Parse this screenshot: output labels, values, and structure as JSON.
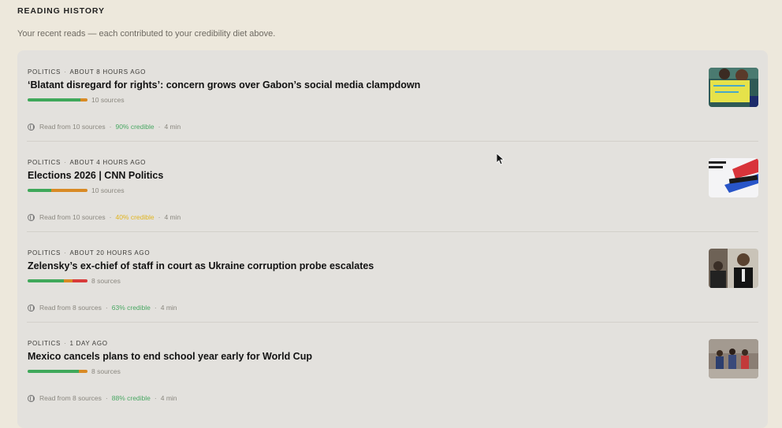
{
  "section": {
    "title": "READING HISTORY",
    "subtitle": "Your recent reads — each contributed to your credibility diet above."
  },
  "items": [
    {
      "category": "POLITICS",
      "time": "ABOUT 8 HOURS AGO",
      "headline": "‘Blatant disregard for rights’: concern grows over Gabon’s social media clampdown",
      "sources_label": "10 sources",
      "read_from": "Read from 10 sources",
      "credibility": "90% credible",
      "credibility_color": "#4aa864",
      "read_time": "4 min",
      "bar": [
        {
          "color": "#3fa85a",
          "share": 0.88
        },
        {
          "color": "#d98a24",
          "share": 0.12
        }
      ],
      "thumb_icon": "protest-photo"
    },
    {
      "category": "POLITICS",
      "time": "ABOUT 4 HOURS AGO",
      "headline": "Elections 2026 | CNN Politics",
      "sources_label": "10 sources",
      "read_from": "Read from 10 sources",
      "credibility": "40% credible",
      "credibility_color": "#e0b521",
      "read_time": "4 min",
      "bar": [
        {
          "color": "#3fa85a",
          "share": 0.4
        },
        {
          "color": "#d98a24",
          "share": 0.6
        }
      ],
      "thumb_icon": "vote-sign-photo"
    },
    {
      "category": "POLITICS",
      "time": "ABOUT 20 HOURS AGO",
      "headline": "Zelensky’s ex-chief of staff in court as Ukraine corruption probe escalates",
      "sources_label": "8 sources",
      "read_from": "Read from 8 sources",
      "credibility": "63% credible",
      "credibility_color": "#4aa864",
      "read_time": "4 min",
      "bar": [
        {
          "color": "#3fa85a",
          "share": 0.6
        },
        {
          "color": "#d98a24",
          "share": 0.15
        },
        {
          "color": "#d83a3a",
          "share": 0.25
        }
      ],
      "thumb_icon": "courtroom-photo"
    },
    {
      "category": "POLITICS",
      "time": "1 DAY AGO",
      "headline": "Mexico cancels plans to end school year early for World Cup",
      "sources_label": "8 sources",
      "read_from": "Read from 8 sources",
      "credibility": "88% credible",
      "credibility_color": "#4aa864",
      "read_time": "4 min",
      "bar": [
        {
          "color": "#3fa85a",
          "share": 0.86
        },
        {
          "color": "#d98a24",
          "share": 0.14
        }
      ],
      "thumb_icon": "students-photo"
    }
  ]
}
